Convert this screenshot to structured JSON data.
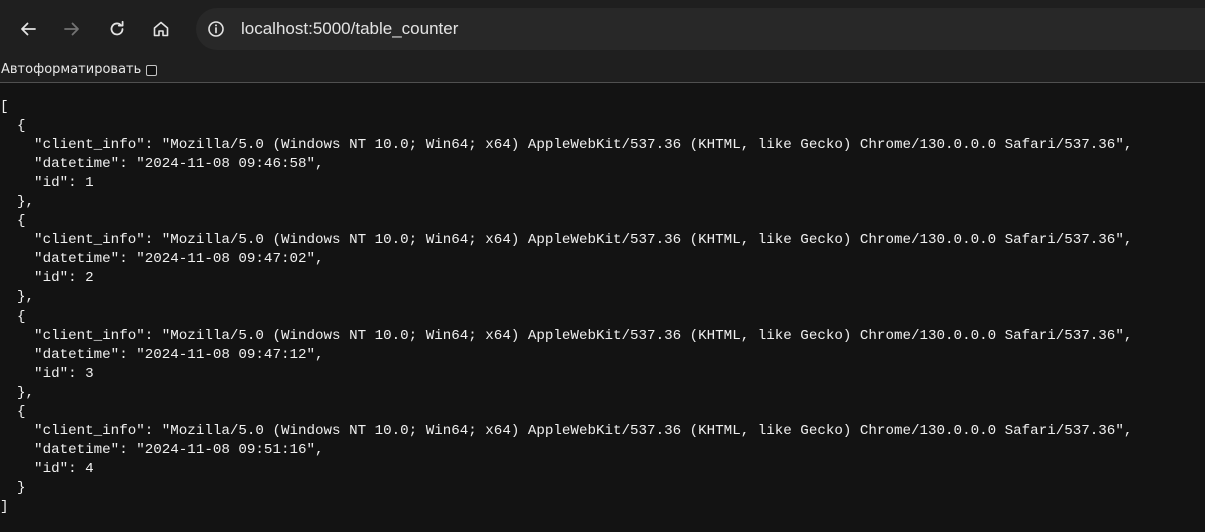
{
  "browser": {
    "url": "localhost:5000/table_counter",
    "nav_icons": [
      "back-arrow-icon",
      "forward-arrow-icon",
      "reload-icon",
      "home-icon",
      "info-icon"
    ]
  },
  "prettyprint": {
    "label": "Автоформатировать",
    "checked": false
  },
  "json_text": "[\n  {\n    \"client_info\": \"Mozilla/5.0 (Windows NT 10.0; Win64; x64) AppleWebKit/537.36 (KHTML, like Gecko) Chrome/130.0.0.0 Safari/537.36\",\n    \"datetime\": \"2024-11-08 09:46:58\",\n    \"id\": 1\n  },\n  {\n    \"client_info\": \"Mozilla/5.0 (Windows NT 10.0; Win64; x64) AppleWebKit/537.36 (KHTML, like Gecko) Chrome/130.0.0.0 Safari/537.36\",\n    \"datetime\": \"2024-11-08 09:47:02\",\n    \"id\": 2\n  },\n  {\n    \"client_info\": \"Mozilla/5.0 (Windows NT 10.0; Win64; x64) AppleWebKit/537.36 (KHTML, like Gecko) Chrome/130.0.0.0 Safari/537.36\",\n    \"datetime\": \"2024-11-08 09:47:12\",\n    \"id\": 3\n  },\n  {\n    \"client_info\": \"Mozilla/5.0 (Windows NT 10.0; Win64; x64) AppleWebKit/537.36 (KHTML, like Gecko) Chrome/130.0.0.0 Safari/537.36\",\n    \"datetime\": \"2024-11-08 09:51:16\",\n    \"id\": 4\n  }\n]"
}
